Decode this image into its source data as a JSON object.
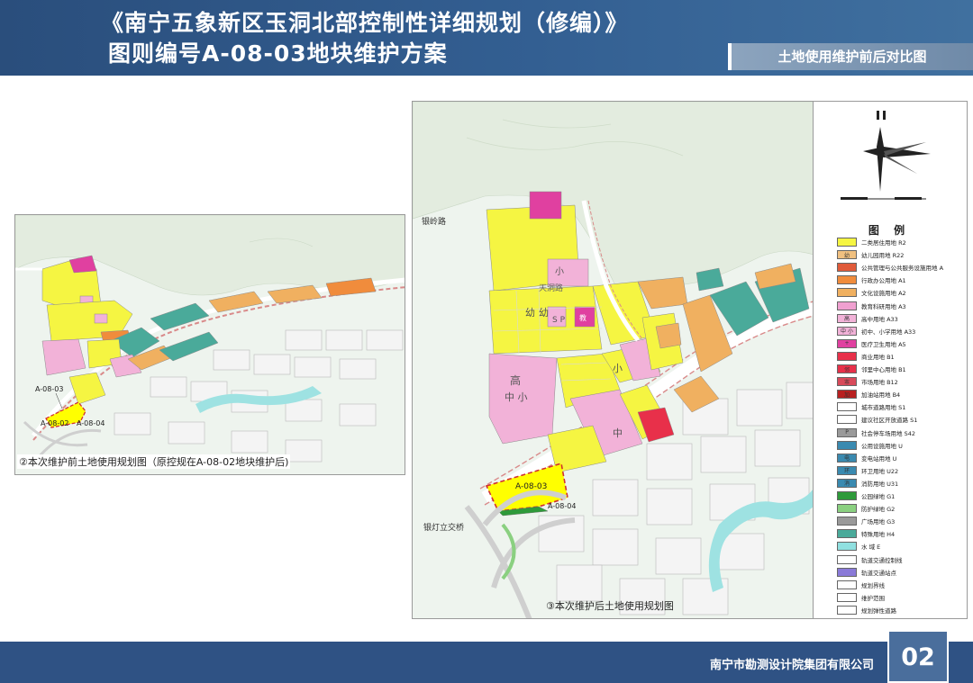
{
  "header": {
    "title_line1": "《南宁五象新区玉洞北部控制性详细规划（修编）》",
    "title_line2": "图则编号A-08-03地块维护方案",
    "section_tab": "土地使用维护前后对比图"
  },
  "left_map": {
    "caption": "②本次维护前土地使用规划图（原控规在A-08-02地块维护后)",
    "labels": {
      "parcel_03": "A-08-03",
      "parcel_02": "A-08-02",
      "parcel_04": "A-08-04"
    }
  },
  "right_map": {
    "caption": "③本次维护后土地使用规划图",
    "labels": {
      "parcel_03": "A-08-03",
      "parcel_04": "A-08-04",
      "road_yinling": "银岭路",
      "road_tiandong": "天洞路",
      "interchange": "银灯立交桥",
      "kindergarten1": "幼",
      "kindergarten2": "幼",
      "school_xiao1": "小",
      "school_xiao2": "小",
      "school_gao": "高",
      "school_zhongxiao": "中 小",
      "school_zhong": "中",
      "sp": "S P",
      "jiao": "教"
    }
  },
  "legend": {
    "title": "图  例",
    "items": [
      {
        "label": "二类居住用地 R2",
        "color": "#f5f542",
        "mark": ""
      },
      {
        "label": "幼儿园用地 R22",
        "color": "#f0c080",
        "mark": "幼"
      },
      {
        "label": "公共管理与公共服务设施用地 A",
        "color": "#e05a3a",
        "mark": ""
      },
      {
        "label": "行政办公用地 A1",
        "color": "#f08c3c",
        "mark": ""
      },
      {
        "label": "文化设施用地 A2",
        "color": "#f0b060",
        "mark": ""
      },
      {
        "label": "教育科研用地 A3",
        "color": "#f0a0d0",
        "mark": ""
      },
      {
        "label": "高中用地 A33",
        "color": "#f2b2d8",
        "mark": "高"
      },
      {
        "label": "初中、小学用地 A33",
        "color": "#f2b2d8",
        "mark": "中 小"
      },
      {
        "label": "医疗卫生用地 A5",
        "color": "#e040a0",
        "mark": "+"
      },
      {
        "label": "商业用地 B1",
        "color": "#e8304a",
        "mark": ""
      },
      {
        "label": "邻里中心用地 B1",
        "color": "#e8304a",
        "mark": "邻"
      },
      {
        "label": "市场用地 B12",
        "color": "#d84a5a",
        "mark": "市"
      },
      {
        "label": "加油站用地 B4",
        "color": "#b82020",
        "mark": "加"
      },
      {
        "label": "城市道路用地 S1",
        "color": "#ffffff",
        "mark": ""
      },
      {
        "label": "建议社区开放道路 S1",
        "color": "#ffffff",
        "mark": ""
      },
      {
        "label": "社会停车场用地 S42",
        "color": "#9a9a9a",
        "mark": "P"
      },
      {
        "label": "公用设施用地 U",
        "color": "#3a8ab0",
        "mark": ""
      },
      {
        "label": "变电站用地 U",
        "color": "#3a8ab0",
        "mark": "电"
      },
      {
        "label": "环卫用地 U22",
        "color": "#3a8ab0",
        "mark": "环"
      },
      {
        "label": "消防用地 U31",
        "color": "#3a8ab0",
        "mark": "消"
      },
      {
        "label": "公园绿地 G1",
        "color": "#2e9a3a",
        "mark": ""
      },
      {
        "label": "防护绿地 G2",
        "color": "#8ad080",
        "mark": ""
      },
      {
        "label": "广场用地 G3",
        "color": "#9a9a9a",
        "mark": ""
      },
      {
        "label": "特殊用地 H4",
        "color": "#4aaa9a",
        "mark": ""
      },
      {
        "label": "水    域 E",
        "color": "#90e0e0",
        "mark": ""
      },
      {
        "label": "轨道交通控制线",
        "color": "#ffffff",
        "mark": ""
      },
      {
        "label": "轨道交通站点",
        "color": "#8a7ad8",
        "mark": ""
      },
      {
        "label": "规划界线",
        "color": "#ffffff",
        "mark": ""
      },
      {
        "label": "维护范围",
        "color": "#ffffff",
        "mark": ""
      },
      {
        "label": "规划弹性道路",
        "color": "#ffffff",
        "mark": ""
      }
    ]
  },
  "footer": {
    "company": "南宁市勘测设计院集团有限公司",
    "page_number": "02"
  }
}
